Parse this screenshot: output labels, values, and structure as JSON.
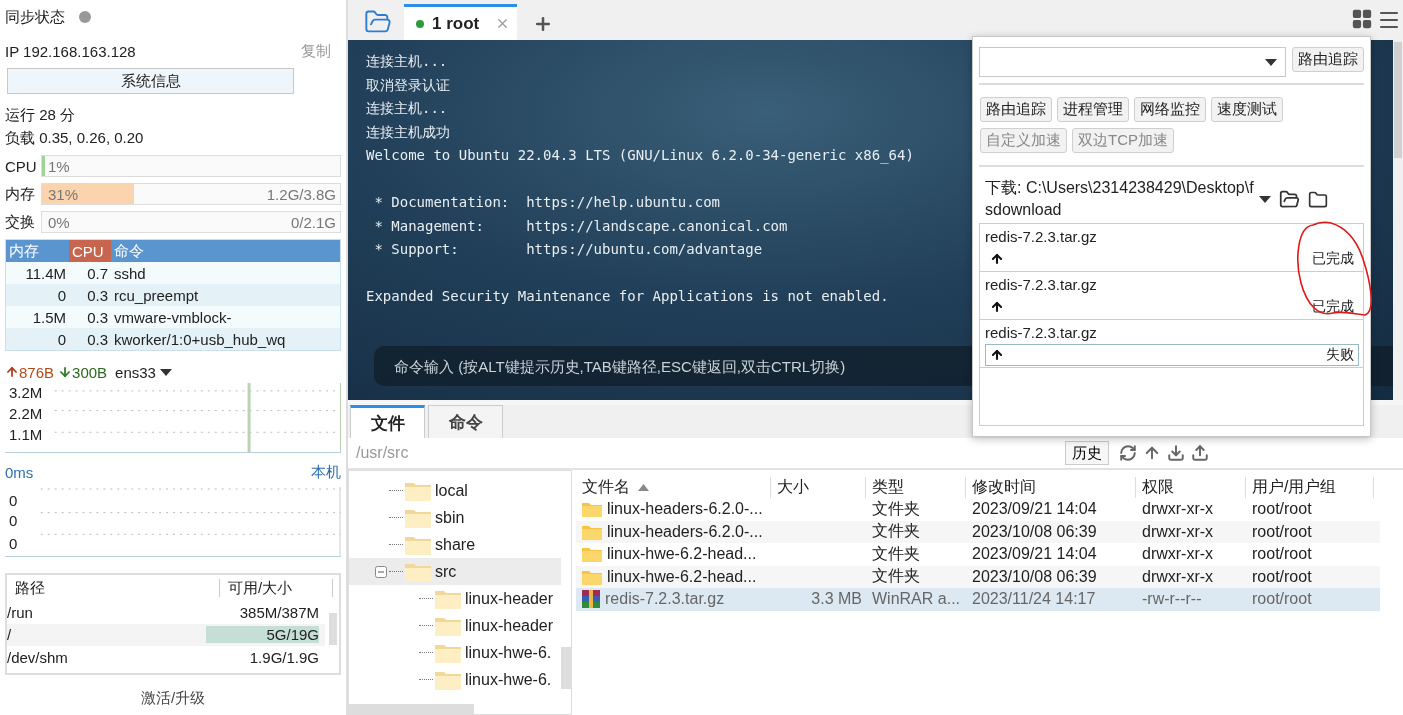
{
  "sidebar": {
    "sync_label": "同步状态",
    "synced": false,
    "ip": "IP 192.168.163.128",
    "copy": "复制",
    "sysinfo_button": "系统信息",
    "uptime": "运行 28 分",
    "load": "负载 0.35, 0.26, 0.20",
    "meters": [
      {
        "label": "CPU",
        "reading": "1%",
        "level": 0.01,
        "color": "#9fd39a"
      },
      {
        "label": "内存",
        "reading": "31%",
        "detail": "1.2G/3.8G",
        "level": 0.31,
        "color": "#fbd3ad"
      },
      {
        "label": "交换",
        "reading": "0%",
        "detail": "0/2.1G",
        "level": 0
      }
    ],
    "process_columns": [
      {
        "label": "内存",
        "sorted": false
      },
      {
        "label": "CPU",
        "sorted": true
      },
      {
        "label": "命令",
        "sorted": false
      }
    ],
    "processes": [
      {
        "memory": "11.4M",
        "cpu": "0.7",
        "command": "sshd"
      },
      {
        "memory": "0",
        "cpu": "0.3",
        "command": "rcu_preempt"
      },
      {
        "memory": "1.5M",
        "cpu": "0.3",
        "command": "vmware-vmblock-"
      },
      {
        "memory": "0",
        "cpu": "0.3",
        "command": "kworker/1:0+usb_hub_wq"
      }
    ],
    "network": {
      "upload": "876B",
      "download": "300B",
      "interface": "ens33",
      "yticks": [
        "3.2M",
        "2.2M",
        "1.1M"
      ]
    },
    "latency": {
      "value": "0ms",
      "host": "本机",
      "yticks": [
        "0",
        "0",
        "0"
      ]
    },
    "disks": {
      "columns": [
        "路径",
        "可用/大小"
      ],
      "rows": [
        {
          "path": "/run",
          "size": "385M/387M",
          "selected": false
        },
        {
          "path": "/",
          "size": "5G/19G",
          "selected": true
        },
        {
          "path": "/dev/shm",
          "size": "1.9G/1.9G",
          "selected": false
        }
      ]
    },
    "activate_link": "激活/升级"
  },
  "session_tabs": [
    {
      "label": "1 root",
      "selected": true,
      "connected": true
    }
  ],
  "terminal": {
    "blocks": [
      [
        "连接主机...",
        "取消登录认证",
        "连接主机...",
        "连接主机成功",
        "Welcome to Ubuntu 22.04.3 LTS (GNU/Linux 6.2.0-34-generic x86_64)"
      ],
      [
        " * Documentation:  https://help.ubuntu.com",
        " * Management:     https://landscape.canonical.com",
        " * Support:        https://ubuntu.com/advantage"
      ],
      [
        "Expanded Security Maintenance for Applications is not enabled."
      ]
    ],
    "command_input": {
      "placeholder": "命令输入 (按ALT键提示历史,TAB键路径,ESC键返回,双击CTRL切换)"
    }
  },
  "tool_panel": {
    "trace_button": "路由追踪",
    "tools": [
      {
        "label": "路由追踪",
        "disabled": false
      },
      {
        "label": "进程管理",
        "disabled": false
      },
      {
        "label": "网络监控",
        "disabled": false
      },
      {
        "label": "速度测试",
        "disabled": false
      },
      {
        "label": "自定义加速",
        "disabled": true
      },
      {
        "label": "双边TCP加速",
        "disabled": true
      }
    ],
    "download_path": "下载: C:\\Users\\2314238429\\Desktop\\fsdownload",
    "transfers": [
      {
        "file": "redis-7.2.3.tar.gz",
        "status": "已完成",
        "selected": false
      },
      {
        "file": "redis-7.2.3.tar.gz",
        "status": "已完成",
        "selected": false
      },
      {
        "file": "redis-7.2.3.tar.gz",
        "status": "失败",
        "selected": true
      }
    ]
  },
  "bottom_tabs": [
    {
      "label": "文件",
      "selected": true
    },
    {
      "label": "命令",
      "selected": false
    }
  ],
  "path": "/usr/src",
  "history_button": "历史",
  "tree": [
    {
      "label": "local",
      "selected": false
    },
    {
      "label": "sbin",
      "selected": false
    },
    {
      "label": "share",
      "selected": false
    },
    {
      "label": "src",
      "selected": true,
      "expanded": true,
      "children": [
        {
          "label": "linux-header",
          "selected": false
        },
        {
          "label": "linux-header",
          "selected": false
        },
        {
          "label": "linux-hwe-6.",
          "selected": false
        },
        {
          "label": "linux-hwe-6.",
          "selected": false
        }
      ]
    }
  ],
  "files": {
    "columns": [
      {
        "label": "文件名",
        "sorted": true
      },
      {
        "label": "大小",
        "sorted": false
      },
      {
        "label": "类型",
        "sorted": false
      },
      {
        "label": "修改时间",
        "sorted": false
      },
      {
        "label": "权限",
        "sorted": false
      },
      {
        "label": "用户/用户组",
        "sorted": false
      }
    ],
    "rows": [
      {
        "kind": "folder",
        "name": "linux-headers-6.2.0-...",
        "size": "",
        "type": "文件夹",
        "modified": "2023/09/21 14:04",
        "permissions": "drwxr-xr-x",
        "owner": "root/root",
        "selected": false
      },
      {
        "kind": "folder",
        "name": "linux-headers-6.2.0-...",
        "type": "文件夹",
        "modified": "2023/10/08 06:39",
        "permissions": "drwxr-xr-x",
        "owner": "root/root",
        "selected": false
      },
      {
        "kind": "folder",
        "name": "linux-hwe-6.2-head...",
        "type": "文件夹",
        "modified": "2023/09/21 14:04",
        "permissions": "drwxr-xr-x",
        "owner": "root/root",
        "selected": false
      },
      {
        "kind": "folder",
        "name": "linux-hwe-6.2-head...",
        "type": "文件夹",
        "modified": "2023/10/08 06:39",
        "permissions": "drwxr-xr-x",
        "owner": "root/root",
        "selected": false
      },
      {
        "kind": "archive",
        "name": "redis-7.2.3.tar.gz",
        "size": "3.3 MB",
        "type": "WinRAR a...",
        "modified": "2023/11/24 14:17",
        "permissions": "-rw-r--r--",
        "owner": "root/root",
        "selected": true
      }
    ]
  }
}
